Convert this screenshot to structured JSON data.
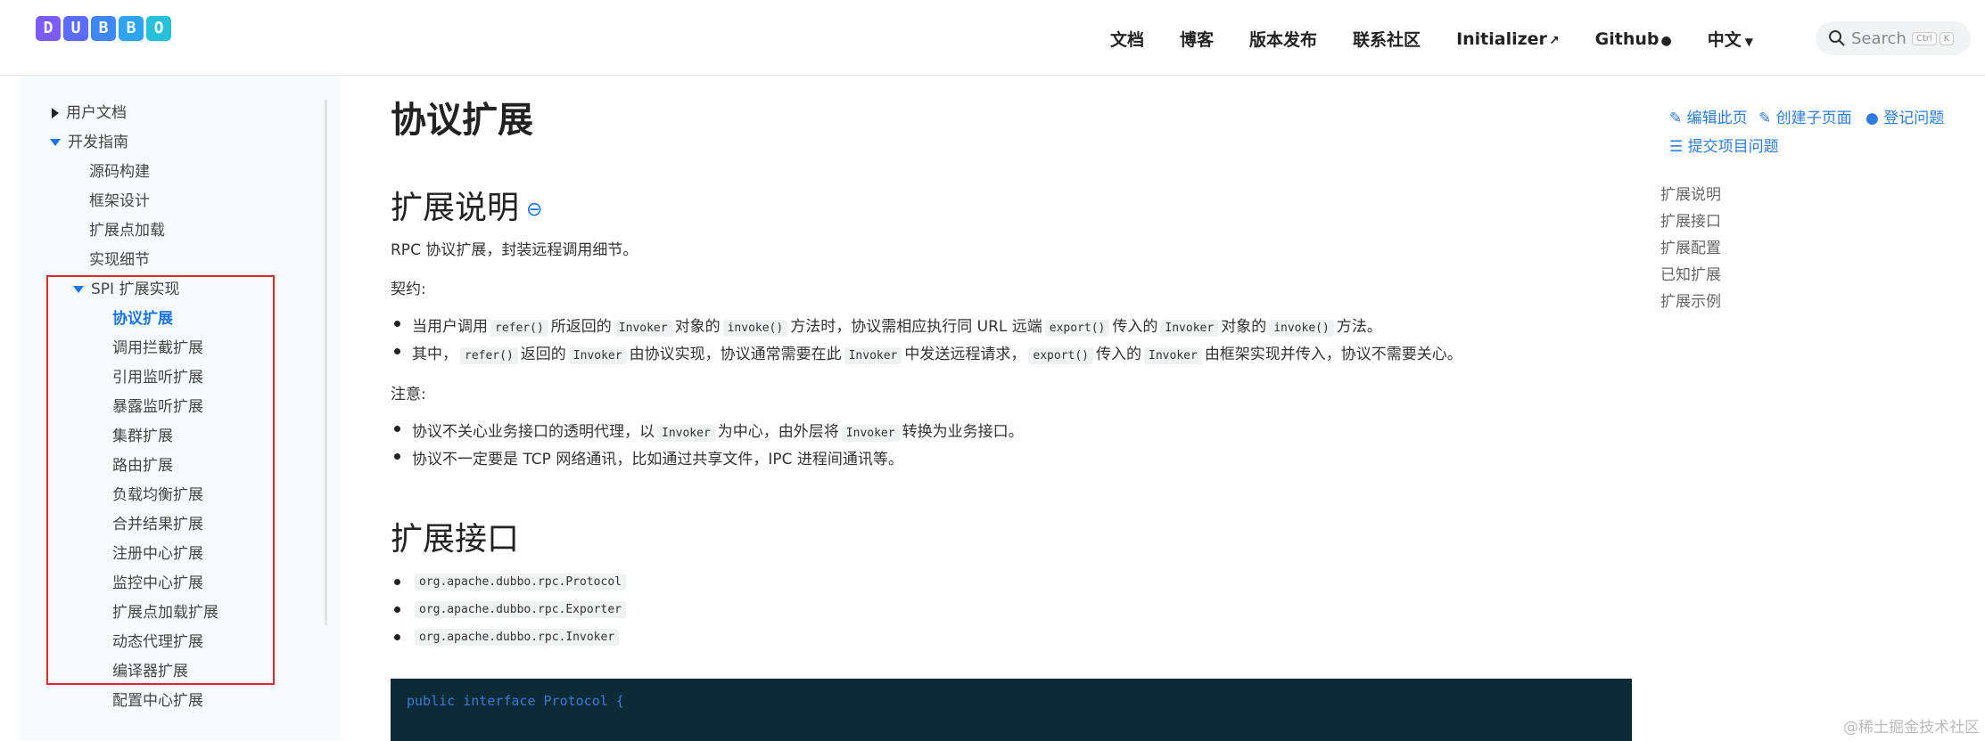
{
  "brand": {
    "logo_letters": [
      "D",
      "U",
      "B",
      "B",
      "O"
    ],
    "logo_colors": [
      "#7b5cf5",
      "#5b6df7",
      "#3f86f6",
      "#2ea4f0",
      "#26c0d8"
    ]
  },
  "header": {
    "nav": [
      "文档",
      "博客",
      "版本发布",
      "联系社区",
      "Initializer",
      "Github",
      "中文"
    ],
    "search_placeholder": "Search",
    "search_kbd": [
      "Ctrl",
      "K"
    ]
  },
  "sidebar": {
    "items": [
      {
        "label": "用户文档"
      },
      {
        "label": "开发指南"
      },
      {
        "label": "源码构建"
      },
      {
        "label": "框架设计"
      },
      {
        "label": "扩展点加载"
      },
      {
        "label": "实现细节"
      },
      {
        "label": "SPI 扩展实现"
      },
      {
        "label": "协议扩展"
      },
      {
        "label": "调用拦截扩展"
      },
      {
        "label": "引用监听扩展"
      },
      {
        "label": "暴露监听扩展"
      },
      {
        "label": "集群扩展"
      },
      {
        "label": "路由扩展"
      },
      {
        "label": "负载均衡扩展"
      },
      {
        "label": "合并结果扩展"
      },
      {
        "label": "注册中心扩展"
      },
      {
        "label": "监控中心扩展"
      },
      {
        "label": "扩展点加载扩展"
      },
      {
        "label": "动态代理扩展"
      },
      {
        "label": "编译器扩展"
      },
      {
        "label": "配置中心扩展"
      }
    ]
  },
  "main": {
    "title": "协议扩展",
    "sec1_title": "扩展说明",
    "intro": "RPC 协议扩展，封装远程调用细节。",
    "contract_label": "契约:",
    "contract": {
      "b1": [
        "当用户调用",
        "refer()",
        "所返回的",
        "Invoker",
        "对象的",
        "invoke()",
        "方法时，协议需相应执行同 URL 远端",
        "export()",
        "传入的",
        "Invoker",
        "对象的",
        "invoke()",
        "方法。"
      ],
      "b2": [
        "其中，",
        "refer()",
        "返回的",
        "Invoker",
        "由协议实现，协议通常需要在此",
        "Invoker",
        "中发送远程请求，",
        "export()",
        "传入的",
        "Invoker",
        "由框架实现并传入，协议不需要关心。"
      ]
    },
    "note_label": "注意:",
    "notes": {
      "b1": [
        "协议不关心业务接口的透明代理，以",
        "Invoker",
        "为中心，由外层将",
        "Invoker",
        "转换为业务接口。"
      ],
      "b2": "协议不一定要是 TCP 网络通讯，比如通过共享文件，IPC 进程间通讯等。"
    },
    "sec2_title": "扩展接口",
    "interfaces": [
      "org.apache.dubbo.rpc.Protocol",
      "org.apache.dubbo.rpc.Exporter",
      "org.apache.dubbo.rpc.Invoker"
    ],
    "code_first_line": "public interface Protocol {"
  },
  "toc": {
    "actions": [
      "编辑此页",
      "创建子页面",
      "登记问题",
      "提交项目问题"
    ],
    "links": [
      "扩展说明",
      "扩展接口",
      "扩展配置",
      "已知扩展",
      "扩展示例"
    ]
  },
  "watermark": "@稀土掘金技术社区"
}
